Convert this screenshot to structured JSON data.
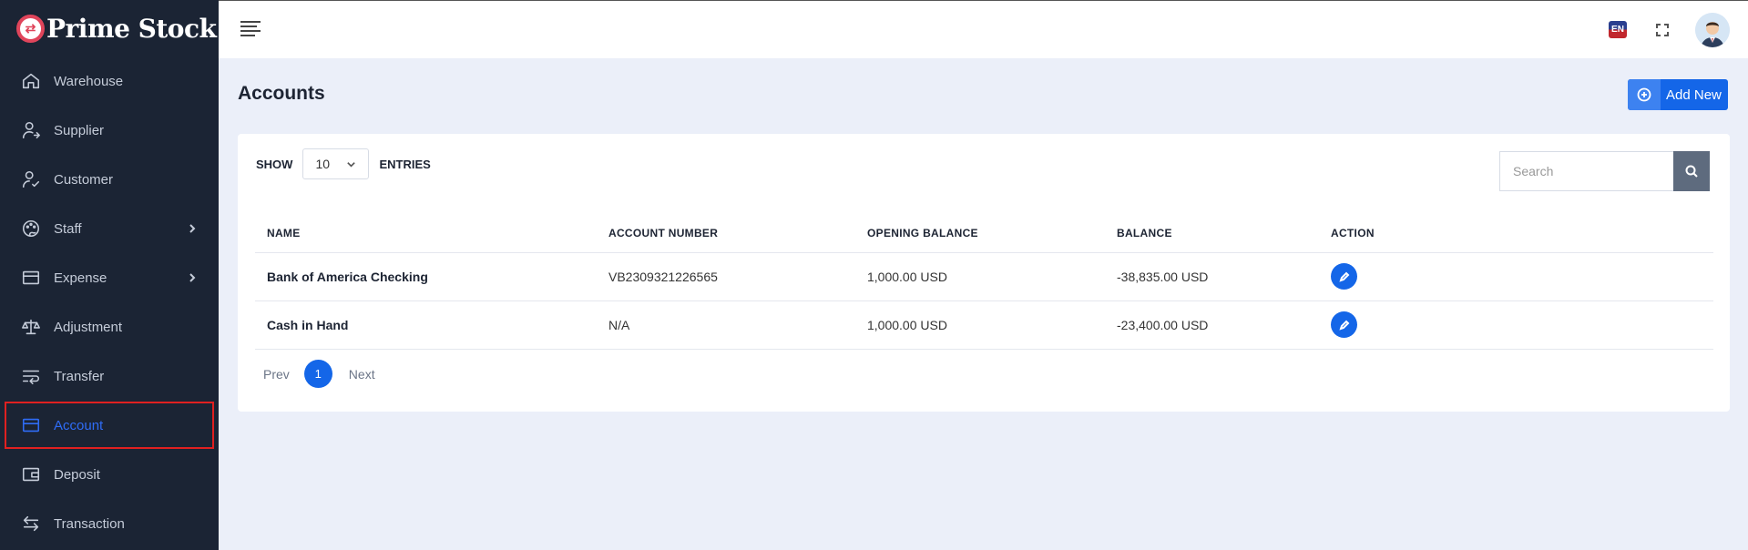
{
  "brand": {
    "logo_glyph": "⇄",
    "name": "Prime Stock"
  },
  "sidebar": {
    "items": [
      {
        "label": "Warehouse",
        "icon": "home-icon"
      },
      {
        "label": "Supplier",
        "icon": "user-arrow-icon"
      },
      {
        "label": "Customer",
        "icon": "user-check-icon"
      },
      {
        "label": "Staff",
        "icon": "palette-icon",
        "has_submenu": true
      },
      {
        "label": "Expense",
        "icon": "card-icon",
        "has_submenu": true
      },
      {
        "label": "Adjustment",
        "icon": "scale-icon"
      },
      {
        "label": "Transfer",
        "icon": "wrap-arrow-icon"
      },
      {
        "label": "Account",
        "icon": "card-icon",
        "active": true
      },
      {
        "label": "Deposit",
        "icon": "wallet-icon"
      },
      {
        "label": "Transaction",
        "icon": "swap-icon"
      }
    ]
  },
  "header": {
    "language": "EN"
  },
  "page": {
    "title": "Accounts",
    "add_button_label": "Add New"
  },
  "table_controls": {
    "show_label": "SHOW",
    "entries_value": "10",
    "entries_label": "ENTRIES",
    "search_placeholder": "Search"
  },
  "table": {
    "columns": [
      "NAME",
      "ACCOUNT NUMBER",
      "OPENING BALANCE",
      "BALANCE",
      "ACTION"
    ],
    "rows": [
      {
        "name": "Bank of America Checking",
        "account_number": "VB2309321226565",
        "opening_balance": "1,000.00 USD",
        "balance": "-38,835.00 USD"
      },
      {
        "name": "Cash in Hand",
        "account_number": "N/A",
        "opening_balance": "1,000.00 USD",
        "balance": "-23,400.00 USD"
      }
    ]
  },
  "pagination": {
    "prev_label": "Prev",
    "current_page": "1",
    "next_label": "Next"
  },
  "colors": {
    "sidebar_bg": "#1b2434",
    "accent": "#1466e8",
    "active_item": "#2f6cf6",
    "highlight_outline": "#e02020",
    "content_bg": "#ebeff9"
  }
}
